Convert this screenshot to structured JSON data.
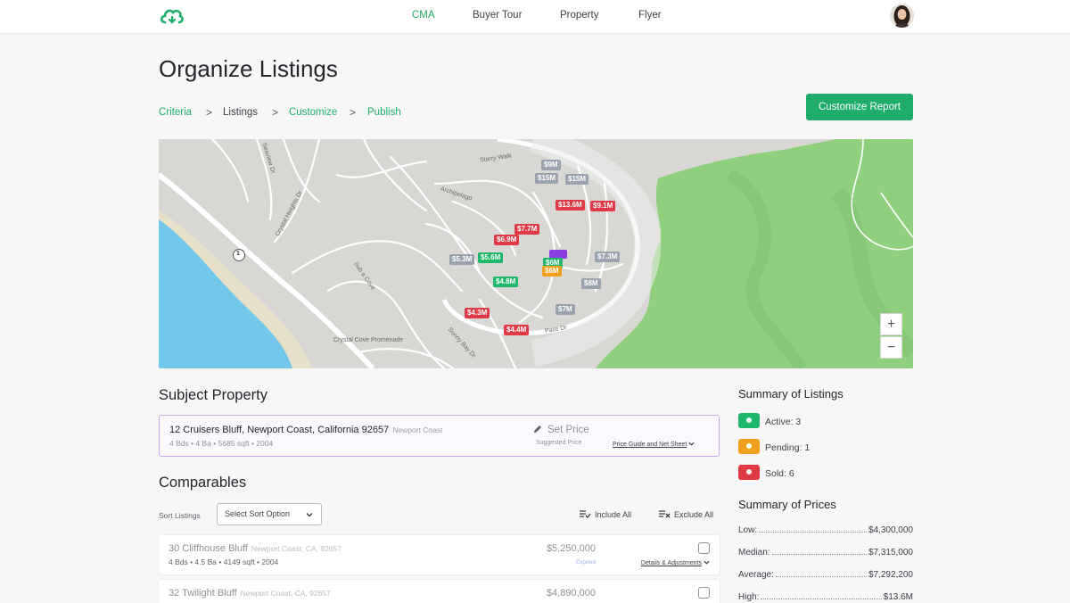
{
  "nav": {
    "items": [
      "CMA",
      "Buyer Tour",
      "Property",
      "Flyer"
    ],
    "active": "CMA"
  },
  "colors": {
    "accent": "#1fae6a",
    "sold": "#e03a45",
    "active": "#1fb86a",
    "pending": "#f0a01e",
    "subject": "#8a3fe0",
    "neutral_pin": "#9aa3ad",
    "park": "#8fcf7e",
    "water": "#72c7ea"
  },
  "page": {
    "title": "Organize Listings"
  },
  "breadcrumb": {
    "criteria": "Criteria",
    "listings": "Listings",
    "customize": "Customize",
    "publish": "Publish",
    "separator": ">"
  },
  "toolbar": {
    "customize_report": "Customize Report"
  },
  "map": {
    "pins": [
      {
        "label": "$9M",
        "status": "gray"
      },
      {
        "label": "$15M",
        "status": "gray"
      },
      {
        "label": "$15M",
        "status": "gray"
      },
      {
        "label": "$13.6M",
        "status": "sold"
      },
      {
        "label": "$9.1M",
        "status": "sold"
      },
      {
        "label": "$7.7M",
        "status": "sold"
      },
      {
        "label": "$6.9M",
        "status": "sold"
      },
      {
        "label": "$5.3M",
        "status": "gray"
      },
      {
        "label": "$5.6M",
        "status": "active"
      },
      {
        "label": "$6M",
        "status": "active"
      },
      {
        "label": "$6M",
        "status": "pending"
      },
      {
        "label": "$7.3M",
        "status": "gray"
      },
      {
        "label": "$4.8M",
        "status": "active"
      },
      {
        "label": "$8M",
        "status": "gray"
      },
      {
        "label": "$4.3M",
        "status": "sold"
      },
      {
        "label": "$7M",
        "status": "gray"
      },
      {
        "label": "$4.4M",
        "status": "sold"
      }
    ],
    "streets": [
      "Seaview Dr",
      "Crystal Heights Dr",
      "Starry Walk",
      "Archipelago",
      "Sub a Cove",
      "Crystal Cove Promenade",
      "Sunny Bay Dr",
      "Pass Dr"
    ],
    "route_marker": "1",
    "zoom_in": "+",
    "zoom_out": "−"
  },
  "subject": {
    "heading": "Subject Property",
    "address": "12 Cruisers Bluff, Newport Coast, California 92657",
    "area": "Newport Coast",
    "specs": "4 Bds • 4 Ba • 5685 sqft • 2004",
    "set_price": "Set Price",
    "suggested": "Suggested Price",
    "price_guide": "Price Guide and Net Sheet"
  },
  "comparables": {
    "heading": "Comparables",
    "sort_label": "Sort Listings",
    "sort_value": "Select Sort Option",
    "include_all": "Include All",
    "exclude_all": "Exclude All",
    "rows": [
      {
        "address": "30 Cliffhouse Bluff",
        "area": "Newport Coast, CA, 92657",
        "specs": "4 Bds • 4.5 Ba • 4149 sqft • 2004",
        "price": "$5,250,000",
        "status": "Expired",
        "details": "Details & Adjustments"
      },
      {
        "address": "32 Twilight Bluff",
        "area": "Newport Coast, CA, 92657",
        "specs": "",
        "price": "$4,890,000",
        "status": "",
        "details": ""
      }
    ]
  },
  "summary_listings": {
    "heading": "Summary of Listings",
    "active": "Active: 3",
    "pending": "Pending: 1",
    "sold": "Sold: 6"
  },
  "summary_prices": {
    "heading": "Summary of Prices",
    "rows": [
      {
        "label": "Low:",
        "value": "$4,300,000"
      },
      {
        "label": "Median:",
        "value": "$7,315,000"
      },
      {
        "label": "Average:",
        "value": "$7,292,200"
      },
      {
        "label": "High:",
        "value": "$13.6M"
      }
    ]
  }
}
